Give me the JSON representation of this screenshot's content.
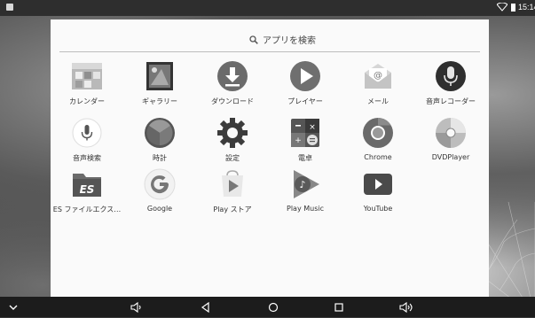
{
  "status_bar": {
    "time": "15:14"
  },
  "search": {
    "placeholder": "アプリを検索"
  },
  "apps": [
    {
      "label": "カレンダー",
      "icon": "calendar-icon"
    },
    {
      "label": "ギャラリー",
      "icon": "gallery-icon"
    },
    {
      "label": "ダウンロード",
      "icon": "download-icon"
    },
    {
      "label": "プレイヤー",
      "icon": "player-icon"
    },
    {
      "label": "メール",
      "icon": "email-icon"
    },
    {
      "label": "音声レコーダー",
      "icon": "microphone-icon"
    },
    {
      "label": "音声検索",
      "icon": "voice-search-icon"
    },
    {
      "label": "時計",
      "icon": "clock-icon"
    },
    {
      "label": "設定",
      "icon": "settings-gear-icon"
    },
    {
      "label": "電卓",
      "icon": "calculator-icon"
    },
    {
      "label": "Chrome",
      "icon": "chrome-icon"
    },
    {
      "label": "DVDPlayer",
      "icon": "dvd-icon"
    },
    {
      "label": "ES ファイルエクス…",
      "icon": "es-file-explorer-icon"
    },
    {
      "label": "Google",
      "icon": "google-icon"
    },
    {
      "label": "Play ストア",
      "icon": "play-store-icon"
    },
    {
      "label": "Play Music",
      "icon": "play-music-icon"
    },
    {
      "label": "YouTube",
      "icon": "youtube-icon"
    }
  ],
  "nav": [
    "chevron-down-icon",
    "volume-down-icon",
    "back-icon",
    "home-icon",
    "recents-icon",
    "volume-up-icon"
  ]
}
